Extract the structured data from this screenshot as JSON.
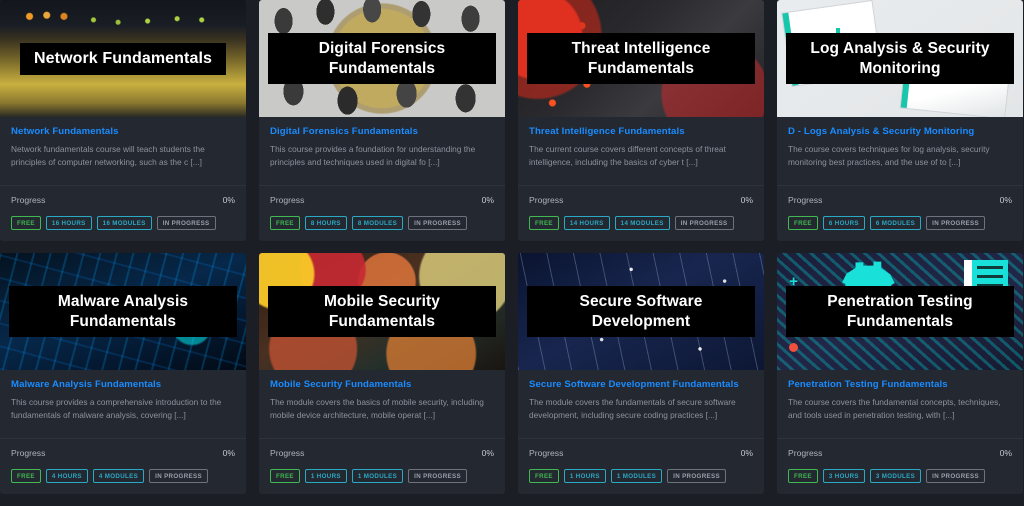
{
  "theme": {
    "page_background": "#1b1e25",
    "card_background": "#242831",
    "title_link_color": "#1a8cff",
    "description_color": "#8d929c",
    "badge_free_color": "#3fb950",
    "badge_info_color": "#2aa9c4",
    "badge_status_color": "#9aa0aa"
  },
  "labels": {
    "progress": "Progress"
  },
  "courses": [
    {
      "thumb_title": "Network Fundamentals",
      "thumb_art": "art-network",
      "title": "Network Fundamentals",
      "description": "Network fundamentals course will teach students the principles of computer networking, such as the c [...]",
      "progress_label": "Progress",
      "progress_value": "0%",
      "badges": {
        "price": "FREE",
        "hours": "16 HOURS",
        "modules": "16 MODULES",
        "status": "IN PROGRESS"
      }
    },
    {
      "thumb_title": "Digital Forensics Fundamentals",
      "thumb_art": "art-forensics",
      "title": "Digital Forensics Fundamentals",
      "description": "This course provides a foundation for understanding the principles and techniques used in digital fo [...]",
      "progress_label": "Progress",
      "progress_value": "0%",
      "badges": {
        "price": "FREE",
        "hours": "8 HOURS",
        "modules": "8 MODULES",
        "status": "IN PROGRESS"
      }
    },
    {
      "thumb_title": "Threat Intelligence Fundamentals",
      "thumb_art": "art-threat",
      "title": "Threat Intelligence Fundamentals",
      "description": "The current course covers different concepts of threat intelligence, including the basics of cyber t [...]",
      "progress_label": "Progress",
      "progress_value": "0%",
      "badges": {
        "price": "FREE",
        "hours": "14 HOURS",
        "modules": "14 MODULES",
        "status": "IN PROGRESS"
      }
    },
    {
      "thumb_title": "Log Analysis & Security Monitoring",
      "thumb_art": "art-logs",
      "title": "D - Logs Analysis & Security Monitoring",
      "description": "The course covers techniques for log analysis, security monitoring best practices, and the use of to [...]",
      "progress_label": "Progress",
      "progress_value": "0%",
      "badges": {
        "price": "FREE",
        "hours": "6 HOURS",
        "modules": "6 MODULES",
        "status": "IN PROGRESS"
      }
    },
    {
      "thumb_title": "Malware Analysis Fundamentals",
      "thumb_art": "art-malware",
      "title": "Malware Analysis Fundamentals",
      "description": "This course provides a comprehensive introduction to the fundamentals of malware analysis, covering [...]",
      "progress_label": "Progress",
      "progress_value": "0%",
      "badges": {
        "price": "FREE",
        "hours": "4 HOURS",
        "modules": "4 MODULES",
        "status": "IN PROGRESS"
      }
    },
    {
      "thumb_title": "Mobile Security Fundamentals",
      "thumb_art": "art-mobile",
      "title": "Mobile Security Fundamentals",
      "description": "The module covers the basics of mobile security, including mobile device architecture, mobile operat [...]",
      "progress_label": "Progress",
      "progress_value": "0%",
      "badges": {
        "price": "FREE",
        "hours": "1 HOURS",
        "modules": "1 MODULES",
        "status": "IN PROGRESS"
      }
    },
    {
      "thumb_title": "Secure Software Development",
      "thumb_art": "art-secure",
      "title": "Secure Software Development Fundamentals",
      "description": "The module covers the fundamentals of secure software development, including secure coding practices [...]",
      "progress_label": "Progress",
      "progress_value": "0%",
      "badges": {
        "price": "FREE",
        "hours": "1 HOURS",
        "modules": "1 MODULES",
        "status": "IN PROGRESS"
      }
    },
    {
      "thumb_title": "Penetration Testing Fundamentals",
      "thumb_art": "art-pentest",
      "title": "Penetration Testing Fundamentals",
      "description": "The course covers the fundamental concepts, techniques, and tools used in penetration testing, with [...]",
      "progress_label": "Progress",
      "progress_value": "0%",
      "badges": {
        "price": "FREE",
        "hours": "3 HOURS",
        "modules": "3 MODULES",
        "status": "IN PROGRESS"
      }
    }
  ]
}
